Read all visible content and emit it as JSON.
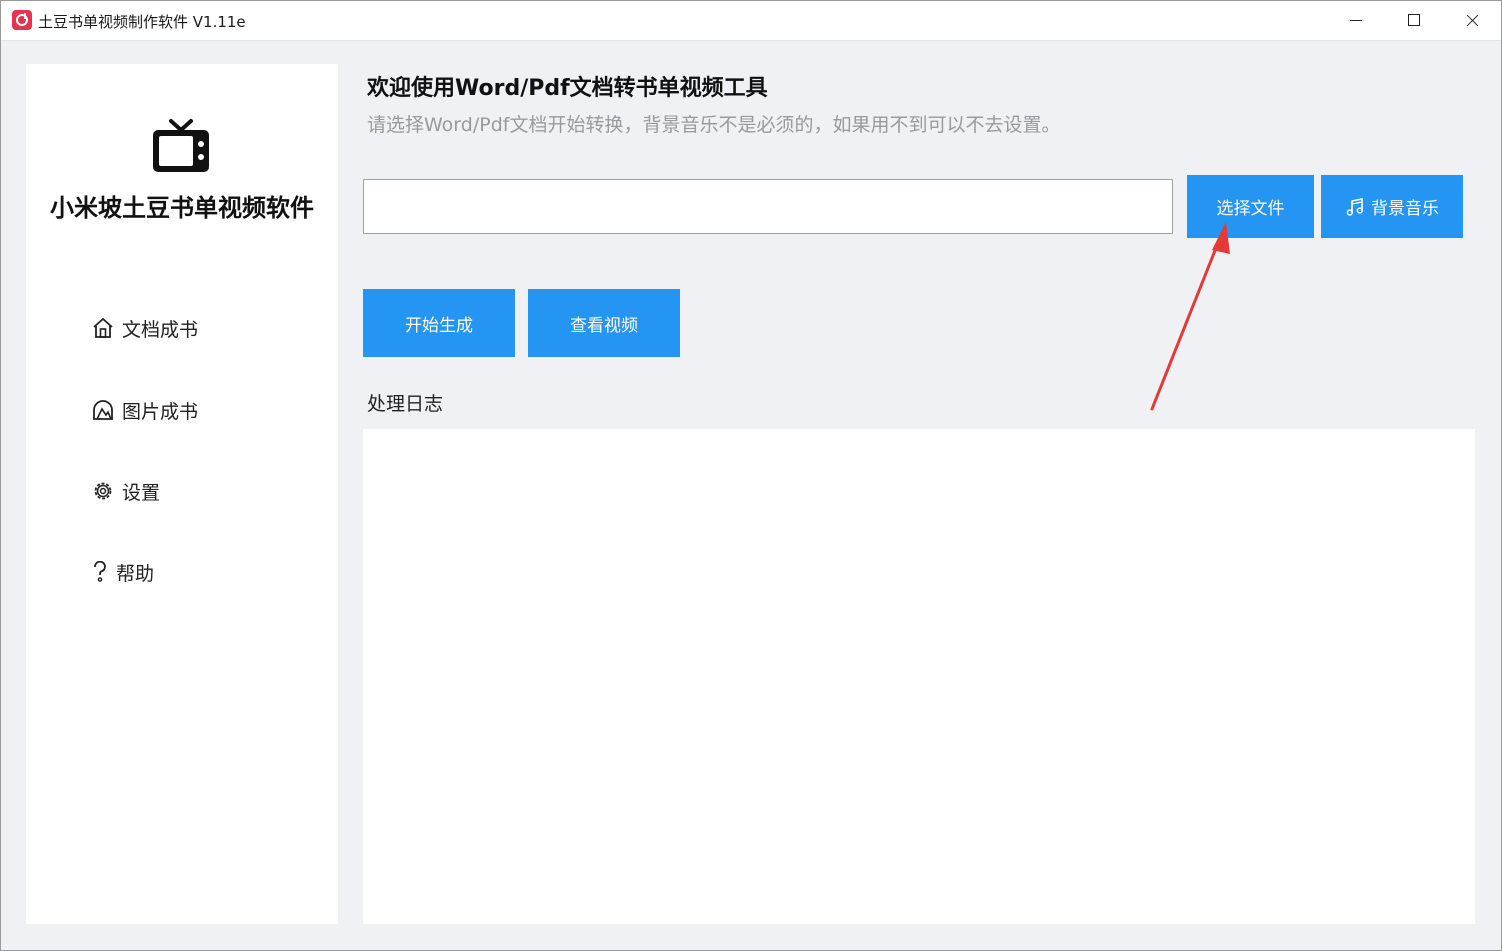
{
  "window": {
    "title": "土豆书单视频制作软件 V1.11e",
    "controls": [
      "minimize",
      "maximize",
      "close"
    ]
  },
  "sidebar": {
    "brand": "小米坡土豆书单视频软件",
    "logo_icon": "tv-icon",
    "items": [
      {
        "label": "文档成书",
        "icon": "home-icon"
      },
      {
        "label": "图片成书",
        "icon": "image-book-icon"
      },
      {
        "label": "设置",
        "icon": "gear-icon"
      },
      {
        "label": "帮助",
        "icon": "question-icon"
      }
    ]
  },
  "main": {
    "title": "欢迎使用Word/Pdf文档转书单视频工具",
    "subtitle": "请选择Word/Pdf文档开始转换，背景音乐不是必须的，如果用不到可以不去设置。",
    "file_input": {
      "value": "",
      "placeholder": ""
    },
    "select_file_button": "选择文件",
    "bg_music_button": "背景音乐",
    "start_button": "开始生成",
    "view_button": "查看视频",
    "log_label": "处理日志",
    "log_content": ""
  },
  "colors": {
    "accent": "#2495f3",
    "background": "#f0f1f5",
    "annotation_arrow": "#e53935"
  }
}
